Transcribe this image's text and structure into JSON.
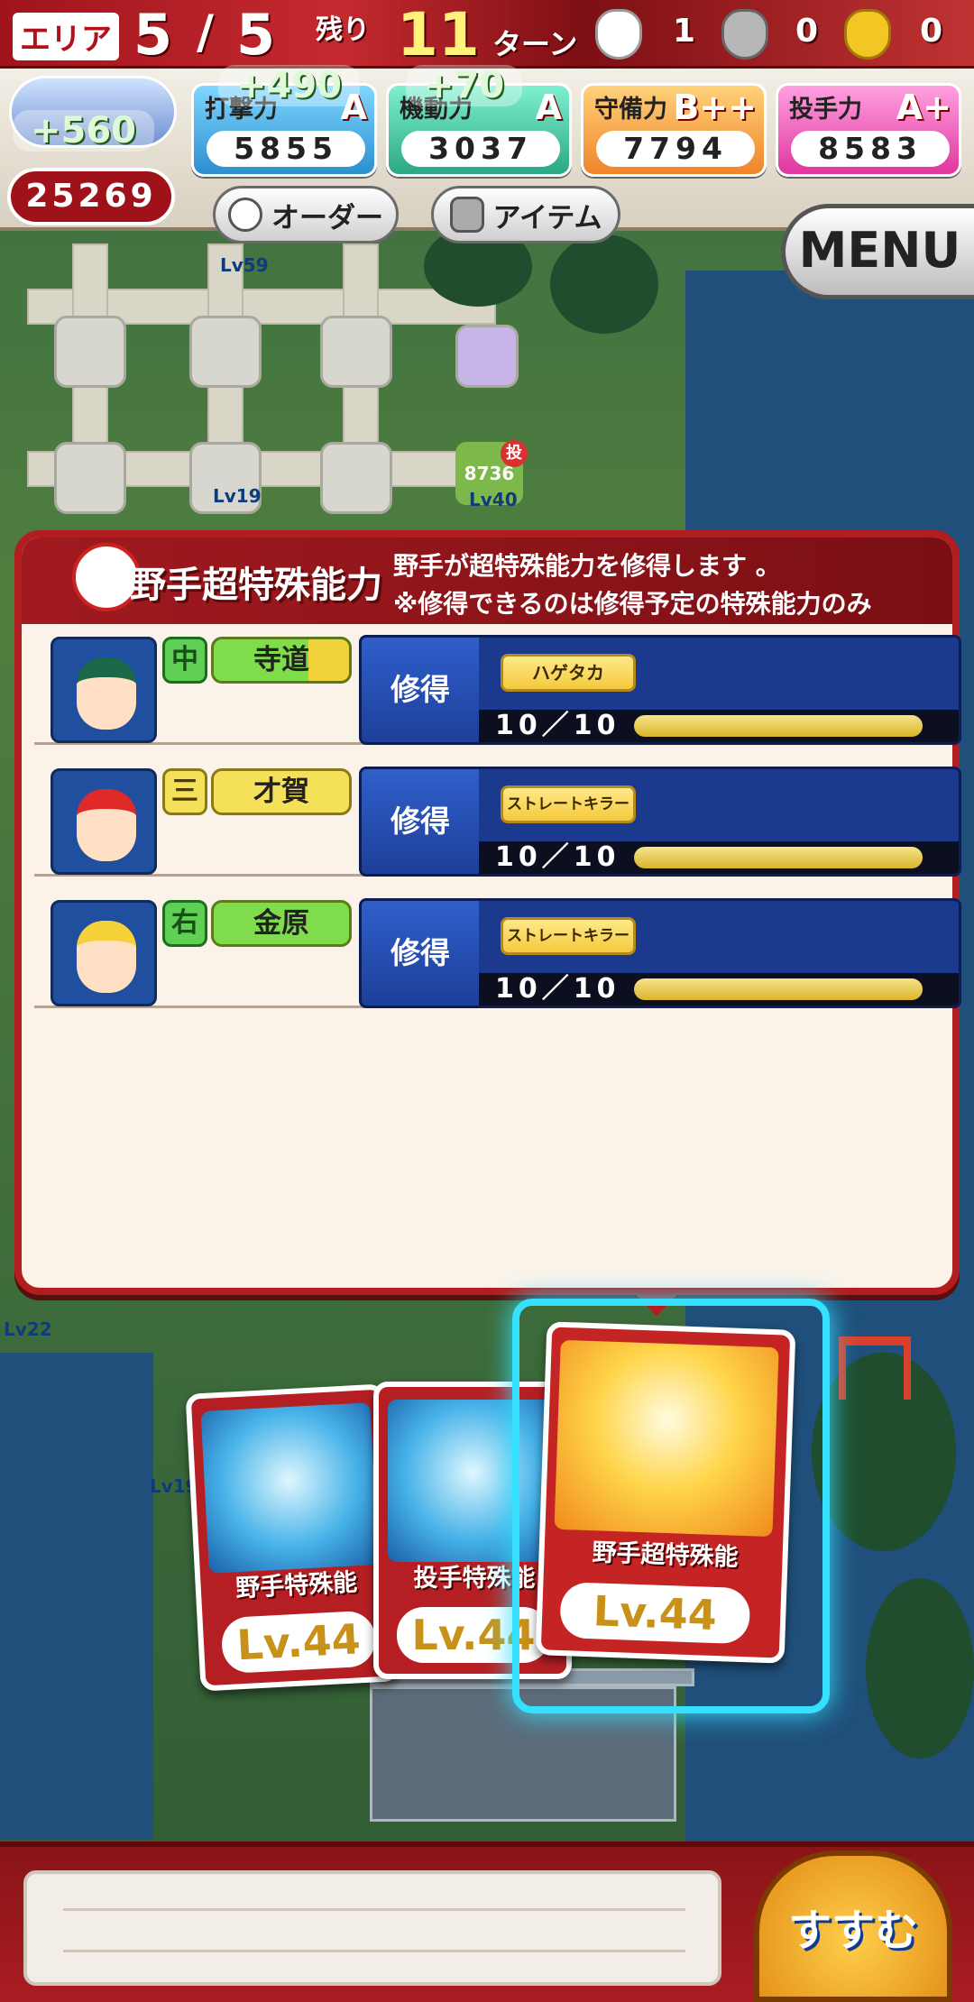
{
  "top_bar": {
    "area_label": "エリア",
    "area_current": "5",
    "area_separator": "/",
    "area_total": "5",
    "remaining_label": "残り",
    "turns_value": "11",
    "turns_label": "ターン",
    "bag_white_count": "1",
    "bag_silver_count": "0",
    "bag_gold_count": "0"
  },
  "team": {
    "overall_bubble": "+560",
    "overall_value": "25269",
    "batting": {
      "label": "打撃力",
      "grade": "A",
      "value": "5855",
      "bubble": "+490"
    },
    "mobility": {
      "label": "機動力",
      "grade": "A",
      "value": "3037",
      "bubble": "+70"
    },
    "defense": {
      "label": "守備力",
      "grade": "B++",
      "value": "7794"
    },
    "pitching": {
      "label": "投手力",
      "grade": "A+",
      "value": "8583"
    }
  },
  "buttons": {
    "order": "オーダー",
    "items": "アイテム",
    "menu": "MENU",
    "advance": "すすむ"
  },
  "map_labels": {
    "lv59": "Lv59",
    "lv19": "Lv19",
    "lv40": "Lv40",
    "lv22": "Lv22",
    "lv19b": "Lv19",
    "score": "8736",
    "tou": "投"
  },
  "popup": {
    "title": "野手超特殊能力",
    "desc_line1": "野手が超特殊能力を修得します 。",
    "desc_line2": "※修得できるのは修得予定の特殊能力のみ",
    "rows": [
      {
        "position": "中",
        "name": "寺道",
        "action": "修得",
        "skill": "ハゲタカ",
        "progress": "10／10",
        "fill": 1.0
      },
      {
        "position": "三",
        "name": "才賀",
        "action": "修得",
        "skill": "ストレートキラー",
        "progress": "10／10",
        "fill": 1.0
      },
      {
        "position": "右",
        "name": "金原",
        "action": "修得",
        "skill": "ストレートキラー",
        "progress": "10／10",
        "fill": 1.0
      }
    ]
  },
  "cards": [
    {
      "title": "野手特殊能",
      "level": "Lv.44"
    },
    {
      "title": "投手特殊能",
      "level": "Lv.44"
    },
    {
      "title": "野手超特殊能",
      "level": "Lv.44"
    }
  ],
  "colors": {
    "accent_red": "#b21d1f",
    "panel_blue": "#1b3a8e",
    "progress_gold": "#e6c23a",
    "highlight_cyan": "#36e0ff"
  }
}
